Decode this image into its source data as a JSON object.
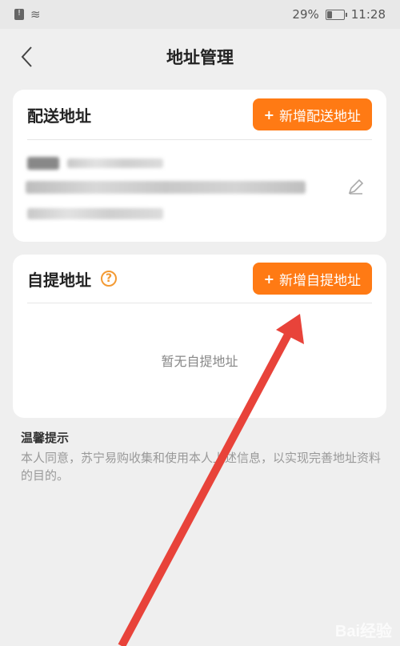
{
  "status_bar": {
    "battery_percent": "29%",
    "battery_level": 0.29,
    "time": "11:28"
  },
  "nav": {
    "title": "地址管理",
    "back_icon": "chevron-left-icon"
  },
  "delivery": {
    "title": "配送地址",
    "add_button_label": "新增配送地址",
    "edit_icon": "pencil-icon"
  },
  "pickup": {
    "title": "自提地址",
    "help_icon": "question-circle-icon",
    "add_button_label": "新增自提地址",
    "empty_text": "暂无自提地址"
  },
  "tips": {
    "title": "温馨提示",
    "body": "本人同意，苏宁易购收集和使用本人上述信息，以实现完善地址资料的目的。"
  },
  "watermark": {
    "text": "Bai经验"
  },
  "colors": {
    "accent": "#ff7a14",
    "help": "#f39a33",
    "arrow": "#e8433a"
  }
}
